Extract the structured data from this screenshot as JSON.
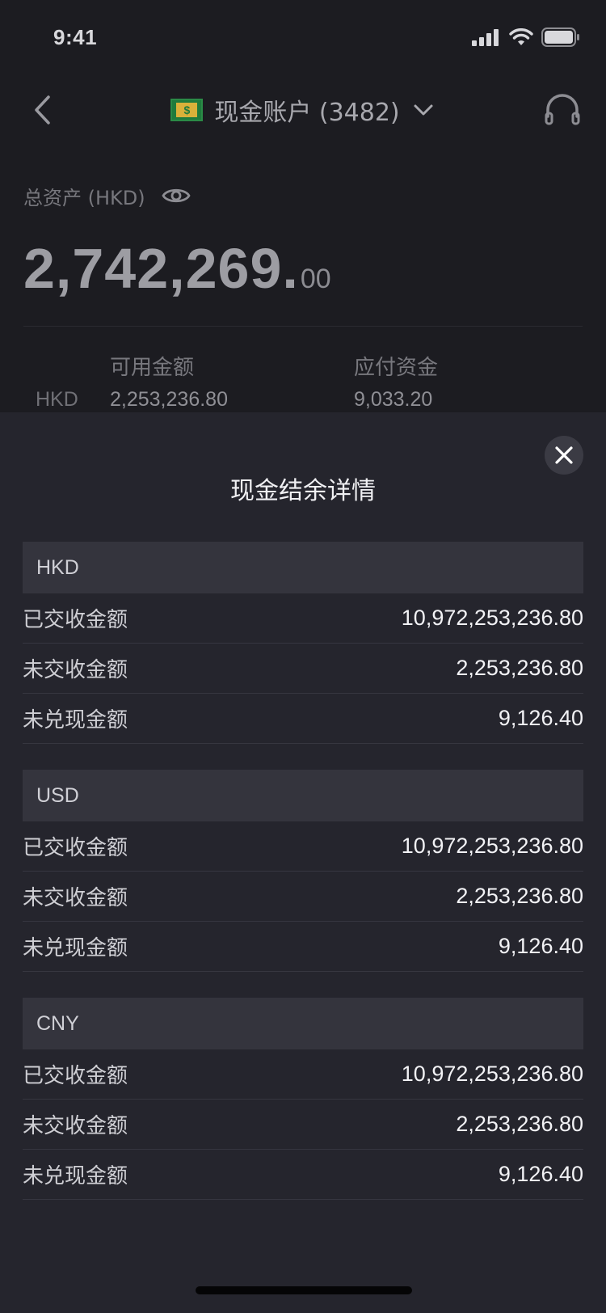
{
  "status_bar": {
    "time": "9:41"
  },
  "nav": {
    "account_title": "现金账户 (3482)"
  },
  "summary": {
    "total_label": "总资产 (HKD)",
    "total_amount_main": "2,742,269.",
    "total_amount_decimal": "00",
    "columns": [
      {
        "label": "可用金额"
      },
      {
        "label": "应付资金"
      }
    ],
    "currency": "HKD",
    "available": "2,253,236.80",
    "payable": "9,033.20"
  },
  "sheet": {
    "title": "现金结余详情",
    "sections": [
      {
        "currency": "HKD",
        "rows": [
          {
            "label": "已交收金额",
            "value": "10,972,253,236.80"
          },
          {
            "label": "未交收金额",
            "value": "2,253,236.80"
          },
          {
            "label": "未兑现金额",
            "value": "9,126.40"
          }
        ]
      },
      {
        "currency": "USD",
        "rows": [
          {
            "label": "已交收金额",
            "value": "10,972,253,236.80"
          },
          {
            "label": "未交收金额",
            "value": "2,253,236.80"
          },
          {
            "label": "未兑现金额",
            "value": "9,126.40"
          }
        ]
      },
      {
        "currency": "CNY",
        "rows": [
          {
            "label": "已交收金额",
            "value": "10,972,253,236.80"
          },
          {
            "label": "未交收金额",
            "value": "2,253,236.80"
          },
          {
            "label": "未兑现金额",
            "value": "9,126.40"
          }
        ]
      }
    ]
  }
}
